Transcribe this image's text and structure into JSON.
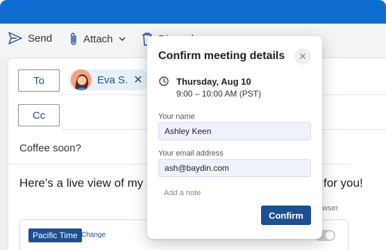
{
  "toolbar": {
    "send_label": "Send",
    "attach_label": "Attach",
    "third_label": "Discard"
  },
  "compose": {
    "to_label": "To",
    "cc_label": "Cc",
    "recipient": "Eva S.",
    "subject": "Coffee soon?",
    "body_left": "Here’s a live view of my ava",
    "body_right": "for you!",
    "browser_label": "owser",
    "timezone": "Pacific Time",
    "timezone_change": "Change"
  },
  "dialog": {
    "title": "Confirm meeting details",
    "date": "Thursday, Aug 10",
    "time": "9:00 – 10:00 AM (PST)",
    "name_label": "Your name",
    "name_value": "Ashley Keen",
    "email_label": "Your email address",
    "email_value": "ash@baydin.com",
    "note_placeholder": "Add a note",
    "confirm_label": "Confirm"
  },
  "colors": {
    "topbar": "#0f6cd0",
    "primary": "#1d4f91",
    "chip_bg": "#e8f1fb",
    "input_bg": "#eef3fb"
  },
  "icons": {
    "send": "send-icon",
    "attach": "paperclip-icon",
    "discard": "trash-icon",
    "close": "close-icon",
    "clock": "clock-icon"
  }
}
